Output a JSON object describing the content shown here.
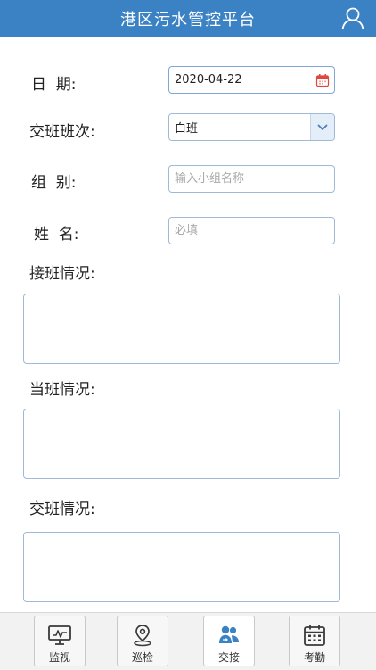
{
  "header": {
    "title": "港区污水管控平台",
    "user_icon": "user-icon"
  },
  "form": {
    "date": {
      "label": "日  期:",
      "value": "2020-04-22",
      "icon": "calendar-icon"
    },
    "shift": {
      "label": "交班班次:",
      "value": "白班",
      "icon": "chevron-down-icon"
    },
    "group": {
      "label": "组  别:",
      "placeholder": "输入小组名称",
      "value": ""
    },
    "name": {
      "label": "姓  名:",
      "placeholder": "必填",
      "value": ""
    },
    "takeover": {
      "label": "接班情况:",
      "value": ""
    },
    "current": {
      "label": "当班情况:",
      "value": ""
    },
    "handover": {
      "label": "交班情况:",
      "value": ""
    }
  },
  "tabs": [
    {
      "label": "监视",
      "icon": "monitor-icon"
    },
    {
      "label": "巡检",
      "icon": "location-pin-icon"
    },
    {
      "label": "交接",
      "icon": "handover-users-icon",
      "active": true
    },
    {
      "label": "考勤",
      "icon": "attendance-calendar-icon"
    }
  ],
  "colors": {
    "header_bg": "#3b82c4",
    "accent": "#3b82c4",
    "field_border": "#9fb9d6",
    "calendar_red": "#e0463b"
  }
}
